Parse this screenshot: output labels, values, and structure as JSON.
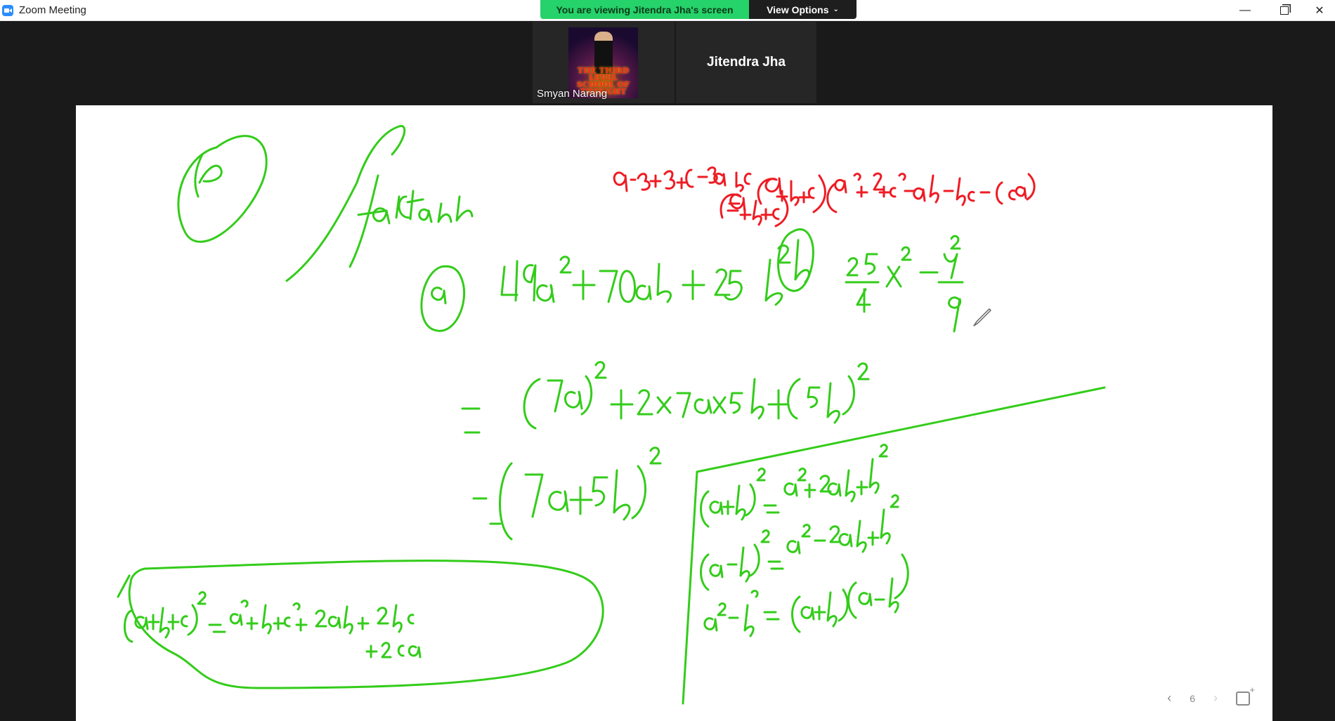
{
  "window": {
    "title": "Zoom Meeting",
    "controls": [
      "minimize-icon",
      "restore-icon",
      "close-icon"
    ]
  },
  "share_banner": {
    "status": "You are viewing Jitendra Jha's screen",
    "view_options_label": "View Options",
    "status_color": "#26d26a"
  },
  "participants": [
    {
      "name": "Smyan Narang",
      "thumb_text": "THE THIRD LEVEL SCHOOL OF THOUGHT"
    },
    {
      "name": "Jitendra Jha"
    }
  ],
  "board": {
    "page_number": "6",
    "ink_colors": {
      "green": "#33cc1a",
      "red": "#ee1c24"
    }
  }
}
